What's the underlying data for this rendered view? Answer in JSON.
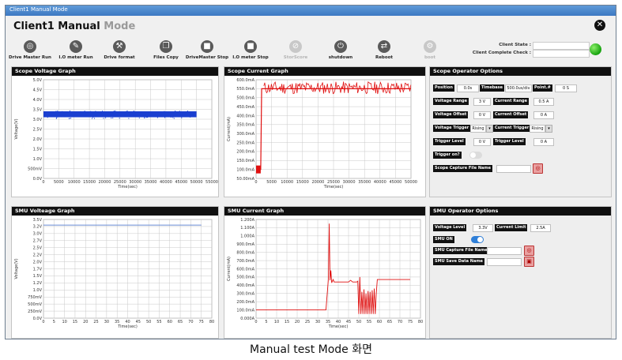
{
  "window_title": "Client1 Manual Mode",
  "app_title": {
    "main": "Client1 Manual",
    "accent": "Mode"
  },
  "close_icon": "close-icon",
  "toolbar": [
    {
      "label": "Drive Master Run",
      "icon": "target-icon",
      "glyph": "◎",
      "enabled": true
    },
    {
      "label": "I.O meter Run",
      "icon": "pencil-icon",
      "glyph": "✎",
      "enabled": true
    },
    {
      "label": "Drive format",
      "icon": "wrench-icon",
      "glyph": "⚒",
      "enabled": true
    },
    {
      "label": "Files Copy",
      "icon": "copy-icon",
      "glyph": "❐",
      "enabled": true
    },
    {
      "label": "DriveMaster Stop",
      "icon": "stop-icon",
      "glyph": "■",
      "enabled": true
    },
    {
      "label": "I.O meter Stop",
      "icon": "stop-icon",
      "glyph": "■",
      "enabled": true
    },
    {
      "label": "StorScore",
      "icon": "score-icon",
      "glyph": "⊘",
      "enabled": false
    },
    {
      "label": "shutdown",
      "icon": "power-icon",
      "glyph": "⏻",
      "enabled": true
    },
    {
      "label": "Reboot",
      "icon": "refresh-icon",
      "glyph": "⇄",
      "enabled": true
    },
    {
      "label": "boot",
      "icon": "boot-icon",
      "glyph": "⚙",
      "enabled": false
    }
  ],
  "client_state": {
    "label": "Client State :",
    "value": ""
  },
  "client_complete": {
    "label": "Client Complete Check :",
    "value": ""
  },
  "status_led_color": "#1fb414",
  "scope_voltage": {
    "title": "Scope Voltage Graph",
    "ylabel": "Voltage(V)",
    "xlabel": "Time(sec)",
    "yticks": [
      "5.0V",
      "4.5V",
      "4.0V",
      "3.5V",
      "3.0V",
      "2.5V",
      "2.0V",
      "1.5V",
      "1.0V",
      "500mV",
      "0.0V"
    ],
    "xticks": [
      "0",
      "5000",
      "10000",
      "15000",
      "20000",
      "25000",
      "30000",
      "35000",
      "40000",
      "45000",
      "50000",
      "55000"
    ]
  },
  "scope_current": {
    "title": "Scope Current Graph",
    "ylabel": "Current(mA)",
    "xlabel": "Time(sec)",
    "yticks": [
      "600.0mA",
      "550.0mA",
      "500.0mA",
      "450.0mA",
      "400.0mA",
      "350.0mA",
      "300.0mA",
      "250.0mA",
      "200.0mA",
      "150.0mA",
      "100.0mA",
      "50.00mA"
    ],
    "xticks": [
      "0",
      "5000",
      "10000",
      "15000",
      "20000",
      "25000",
      "30000",
      "35000",
      "40000",
      "45000",
      "50000"
    ]
  },
  "smu_voltage": {
    "title": "SMU Volteage Graph",
    "ylabel": "Voltage(V)",
    "xlabel": "Time(sec)",
    "yticks": [
      "3.5V",
      "3.2V",
      "3.0V",
      "2.7V",
      "2.5V",
      "2.2V",
      "2.0V",
      "1.7V",
      "1.5V",
      "1.2V",
      "1.0V",
      "750mV",
      "500mV",
      "250mV",
      "0.0V"
    ],
    "xticks": [
      "0",
      "5",
      "10",
      "15",
      "20",
      "25",
      "30",
      "35",
      "40",
      "45",
      "50",
      "55",
      "60",
      "65",
      "70",
      "75",
      "80"
    ]
  },
  "smu_current": {
    "title": "SMU Current Graph",
    "ylabel": "Current(mA)",
    "xlabel": "Time(sec)",
    "yticks": [
      "1.200A",
      "1.100A",
      "1.000A",
      "900.0mA",
      "800.0mA",
      "700.0mA",
      "600.0mA",
      "500.0mA",
      "400.0mA",
      "300.0mA",
      "200.0mA",
      "100.0mA",
      "0.000A"
    ],
    "xticks": [
      "0",
      "5",
      "10",
      "15",
      "20",
      "25",
      "30",
      "35",
      "40",
      "45",
      "50",
      "55",
      "60",
      "65",
      "70",
      "75",
      "80"
    ]
  },
  "scope_options": {
    "title": "Scope Operator Options",
    "position_label": "Position",
    "position_value": "0.0s",
    "timebase_label": "Timebase",
    "timebase_value": "500.0us/div",
    "point_label": "Point.#",
    "point_value": "0 S",
    "vrange_label": "Voltage Range",
    "vrange_value": "3 V",
    "crange_label": "Current Range",
    "crange_value": "0.5 A",
    "voffset_label": "Voltage Offset",
    "voffset_value": "0 V",
    "coffset_label": "Current Offset",
    "coffset_value": "0 A",
    "vtrigger_label": "Voltage Trigger",
    "vtrigger_value": "Rising",
    "ctrigger_label": "Current Trigger",
    "ctrigger_value": "Rising",
    "tlevel_label": "Trigger Level",
    "tlevel_value": "0 V",
    "tlevel2_label": "Trigger Level",
    "tlevel2_value": "0 A",
    "trigger_on_label": "Trigger on?",
    "capture_label": "Scope Capture File Name",
    "capture_value": ""
  },
  "smu_options": {
    "title": "SMU Operator Options",
    "vlevel_label": "Voltage Level",
    "vlevel_value": "3.3V",
    "climit_label": "Current Limit",
    "climit_value": "2.5A",
    "smu_on_label": "SMU ON",
    "capture_label": "SMU Capture File Name",
    "capture_value": "",
    "save_label": "SMU Save Data Name",
    "save_value": ""
  },
  "caption": "Manual test Mode 화면",
  "chart_data": [
    {
      "type": "scatter",
      "title": "Scope Voltage Graph",
      "xlabel": "Time(sec)",
      "ylabel": "Voltage(V)",
      "xlim": [
        0,
        55000
      ],
      "ylim": [
        0,
        5.0
      ],
      "grid": true,
      "series": [
        {
          "color": "#1a3fd0",
          "x_range": [
            0,
            50000
          ],
          "y_band": [
            3.1,
            3.4
          ],
          "center": 3.25
        }
      ]
    },
    {
      "type": "line",
      "title": "Scope Current Graph",
      "xlabel": "Time(sec)",
      "ylabel": "Current(mA)",
      "xlim": [
        0,
        50000
      ],
      "ylim": [
        50,
        600
      ],
      "grid": true,
      "series": [
        {
          "color": "#e01010",
          "x": [
            0,
            1500,
            1800,
            2500,
            50000
          ],
          "y": [
            100,
            100,
            550,
            550,
            550
          ],
          "noise_band": [
            520,
            590
          ]
        }
      ]
    },
    {
      "type": "line",
      "title": "SMU Volteage Graph",
      "xlabel": "Time(sec)",
      "ylabel": "Voltage(V)",
      "xlim": [
        0,
        80
      ],
      "ylim": [
        0,
        3.5
      ],
      "grid": true,
      "series": [
        {
          "color": "#6b8ed6",
          "x": [
            0,
            75
          ],
          "y": [
            3.3,
            3.3
          ]
        }
      ]
    },
    {
      "type": "line",
      "title": "SMU Current Graph",
      "xlabel": "Time(sec)",
      "ylabel": "Current(mA)",
      "xlim": [
        0,
        80
      ],
      "ylim": [
        0,
        1200
      ],
      "grid": true,
      "series": [
        {
          "color": "#e01010",
          "x": [
            0,
            34,
            35.2,
            35.6,
            36,
            36.4,
            36.8,
            37.5,
            38,
            40,
            42,
            44,
            45,
            46,
            47,
            48,
            49,
            49.5,
            50,
            50.5,
            51,
            51.5,
            52,
            52.5,
            53,
            53.5,
            54,
            54.5,
            55,
            55.5,
            56,
            56.5,
            57,
            57.5,
            58,
            58.5,
            59,
            60,
            62,
            64,
            66,
            68,
            70,
            72,
            74,
            75
          ],
          "y": [
            100,
            100,
            480,
            1150,
            460,
            580,
            430,
            470,
            440,
            440,
            440,
            440,
            440,
            460,
            440,
            440,
            440,
            450,
            50,
            500,
            50,
            320,
            50,
            350,
            50,
            300,
            50,
            330,
            50,
            320,
            50,
            340,
            50,
            360,
            50,
            300,
            470,
            470,
            470,
            470,
            470,
            470,
            470,
            470,
            470,
            470
          ]
        }
      ]
    }
  ]
}
